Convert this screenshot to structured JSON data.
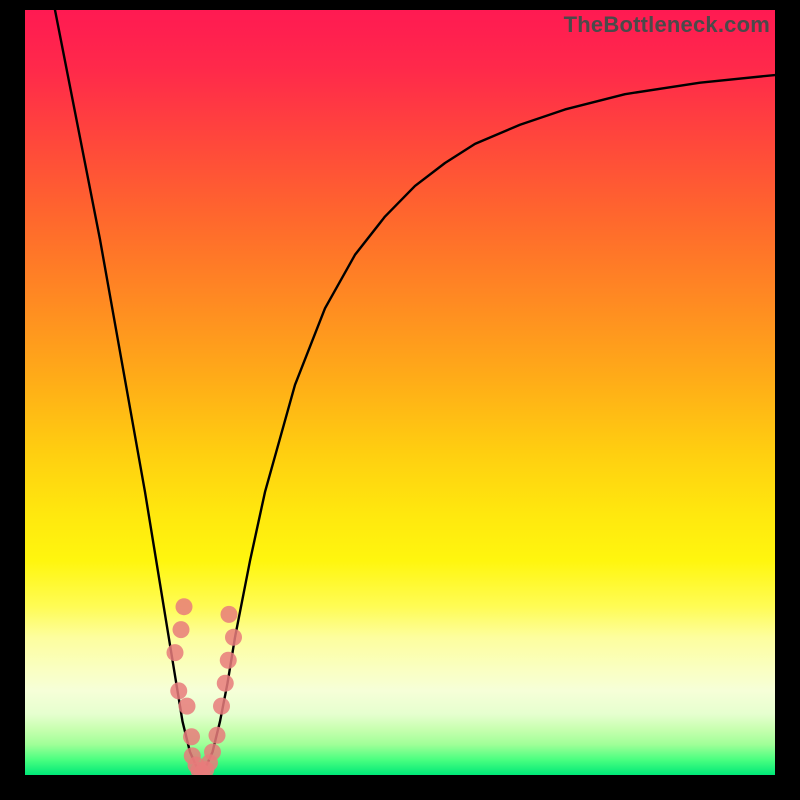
{
  "watermark": "TheBottleneck.com",
  "colors": {
    "frame": "#000000",
    "curve": "#000000",
    "dot": "#e77b7b"
  },
  "chart_data": {
    "type": "line",
    "title": "",
    "xlabel": "",
    "ylabel": "",
    "xlim": [
      0,
      100
    ],
    "ylim": [
      0,
      100
    ],
    "x": [
      4,
      6,
      8,
      10,
      12,
      14,
      16,
      18,
      20,
      21,
      22,
      23,
      23.5,
      24,
      25,
      26,
      27,
      28,
      30,
      32,
      34,
      36,
      38,
      40,
      44,
      48,
      52,
      56,
      60,
      66,
      72,
      80,
      90,
      100
    ],
    "series": [
      {
        "name": "bottleneck-curve",
        "values": [
          100,
          90,
          80,
          70,
          59,
          48,
          37,
          25,
          13,
          7,
          3,
          0.8,
          0.3,
          0.8,
          3,
          7,
          12,
          18,
          28,
          37,
          44,
          51,
          56,
          61,
          68,
          73,
          77,
          80,
          82.5,
          85,
          87,
          89,
          90.5,
          91.5
        ]
      }
    ],
    "dots": [
      {
        "x": 20.5,
        "y": 11
      },
      {
        "x": 20.0,
        "y": 16
      },
      {
        "x": 20.8,
        "y": 19
      },
      {
        "x": 21.2,
        "y": 22
      },
      {
        "x": 21.6,
        "y": 9
      },
      {
        "x": 22.2,
        "y": 5
      },
      {
        "x": 22.3,
        "y": 2.5
      },
      {
        "x": 22.8,
        "y": 1.3
      },
      {
        "x": 23.2,
        "y": 0.6
      },
      {
        "x": 23.6,
        "y": 0.3
      },
      {
        "x": 24.1,
        "y": 0.7
      },
      {
        "x": 24.6,
        "y": 1.6
      },
      {
        "x": 25.0,
        "y": 3
      },
      {
        "x": 25.6,
        "y": 5.2
      },
      {
        "x": 26.2,
        "y": 9
      },
      {
        "x": 26.7,
        "y": 12
      },
      {
        "x": 27.1,
        "y": 15
      },
      {
        "x": 27.2,
        "y": 21
      },
      {
        "x": 27.8,
        "y": 18
      }
    ]
  }
}
